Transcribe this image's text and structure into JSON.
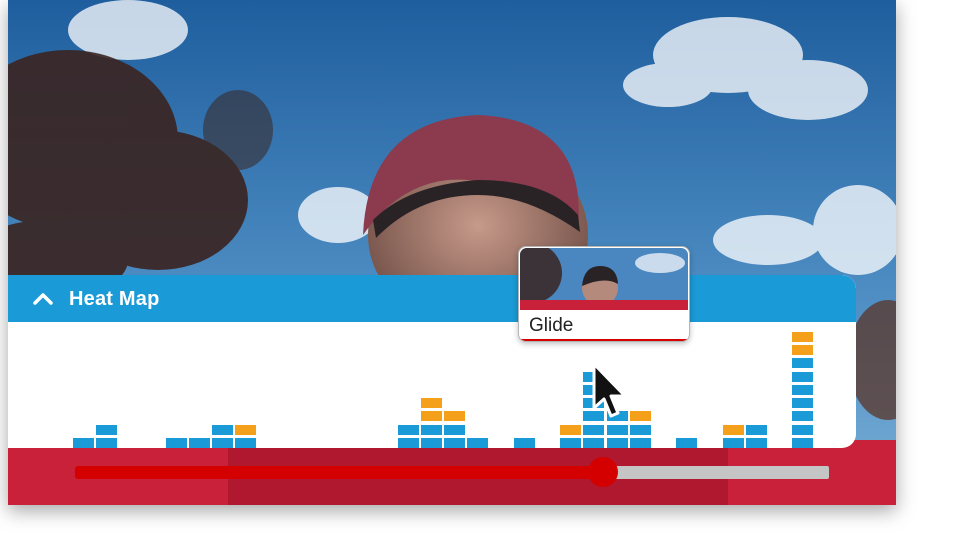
{
  "player": {
    "heatmap": {
      "title": "Heat Map",
      "colors": {
        "header": "#1a9ad6",
        "blue": "#1a9ad6",
        "orange": "#f5a01a"
      },
      "columns": [
        {
          "blue": 1,
          "orange": 0
        },
        {
          "blue": 2,
          "orange": 0
        },
        null,
        null,
        {
          "blue": 1,
          "orange": 0
        },
        {
          "blue": 1,
          "orange": 0
        },
        {
          "blue": 2,
          "orange": 0
        },
        {
          "blue": 1,
          "orange": 1
        },
        null,
        null,
        null,
        null,
        null,
        null,
        {
          "blue": 2,
          "orange": 0
        },
        {
          "blue": 2,
          "orange": 2
        },
        {
          "blue": 2,
          "orange": 1
        },
        {
          "blue": 1,
          "orange": 0
        },
        null,
        {
          "blue": 1,
          "orange": 0
        },
        null,
        {
          "blue": 1,
          "orange": 1
        },
        {
          "blue": 6,
          "orange": 0
        },
        {
          "blue": 3,
          "orange": 0
        },
        {
          "blue": 2,
          "orange": 1
        },
        null,
        {
          "blue": 1,
          "orange": 0
        },
        null,
        {
          "blue": 1,
          "orange": 1
        },
        {
          "blue": 2,
          "orange": 0
        },
        null,
        {
          "blue": 7,
          "orange": 2
        }
      ]
    },
    "preview": {
      "label": "Glide"
    },
    "progress": {
      "played_fraction": 0.7,
      "colors": {
        "played": "#d40000",
        "remaining": "#c5c5c5"
      }
    }
  }
}
